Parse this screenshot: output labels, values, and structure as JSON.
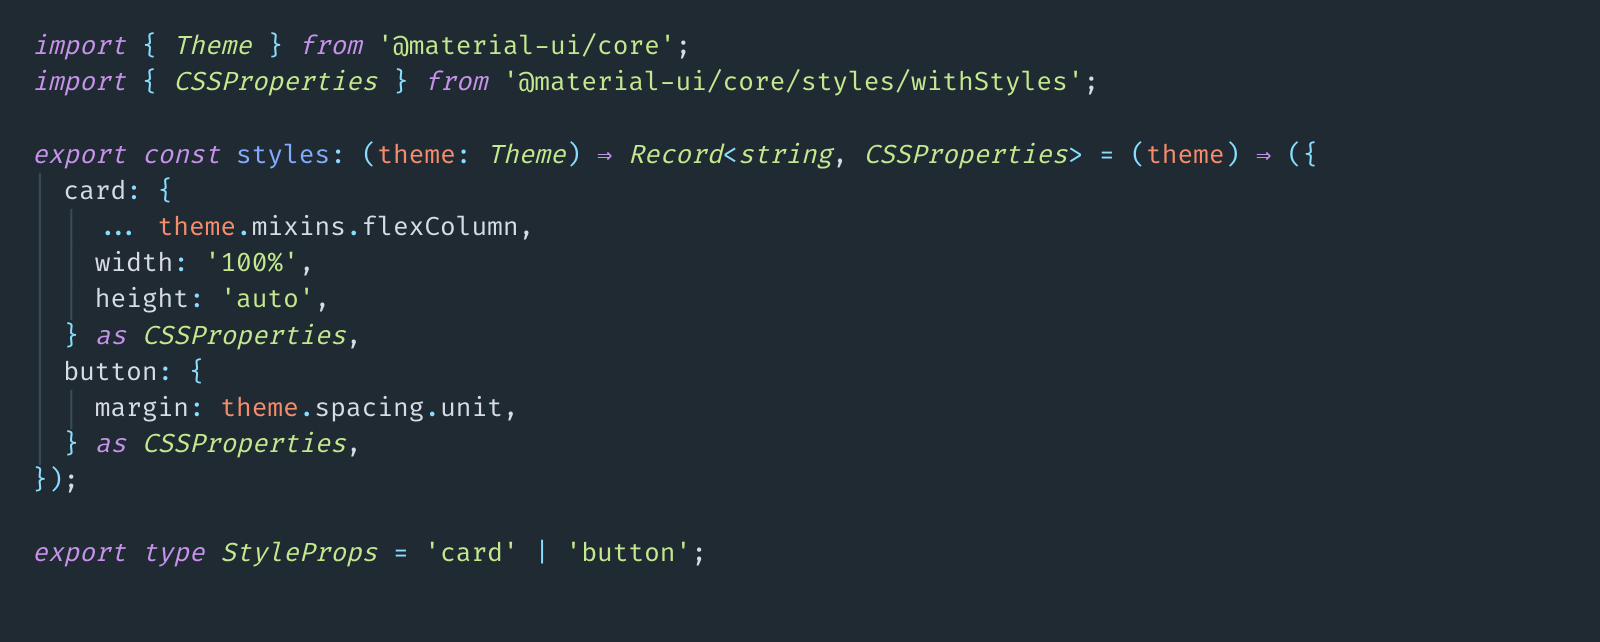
{
  "code": {
    "line1": {
      "import": "import",
      "lbrace": "{",
      "Theme": "Theme",
      "rbrace": "}",
      "from": "from",
      "pkg": "'@material-ui/core'",
      "semi": ";"
    },
    "line2": {
      "import": "import",
      "lbrace": "{",
      "CSSProperties": "CSSProperties",
      "rbrace": "}",
      "from": "from",
      "pkg": "'@material-ui/core/styles/withStyles'",
      "semi": ";"
    },
    "line4": {
      "export": "export",
      "const": "const",
      "styles": "styles",
      "colon": ":",
      "lp": "(",
      "theme1": "theme",
      "colon2": ":",
      "Theme": "Theme",
      "rp": ")",
      "arrow1": "⇒",
      "Record": "Record",
      "lt": "<",
      "string": "string",
      "comma": ",",
      "CSSProperties": "CSSProperties",
      "gt": ">",
      "eq": "=",
      "lp2": "(",
      "theme2": "theme",
      "rp2": ")",
      "arrow2": "⇒",
      "lp3": "(",
      "lbrace": "{"
    },
    "line5": {
      "card": "card",
      "colon": ":",
      "lbrace": "{"
    },
    "line6": {
      "spread": "...",
      "theme": "theme",
      "dot1": ".",
      "mixins": "mixins",
      "dot2": ".",
      "flexColumn": "flexColumn",
      "comma": ","
    },
    "line7": {
      "width": "width",
      "colon": ":",
      "val": "'100%'",
      "comma": ","
    },
    "line8": {
      "height": "height",
      "colon": ":",
      "val": "'auto'",
      "comma": ","
    },
    "line9": {
      "rbrace": "}",
      "as": "as",
      "CSSProperties": "CSSProperties",
      "comma": ","
    },
    "line10": {
      "button": "button",
      "colon": ":",
      "lbrace": "{"
    },
    "line11": {
      "margin": "margin",
      "colon": ":",
      "theme": "theme",
      "dot1": ".",
      "spacing": "spacing",
      "dot2": ".",
      "unit": "unit",
      "comma": ","
    },
    "line12": {
      "rbrace": "}",
      "as": "as",
      "CSSProperties": "CSSProperties",
      "comma": ","
    },
    "line13": {
      "rbrace": "}",
      "rp": ")",
      "semi": ";"
    },
    "line15": {
      "export": "export",
      "type": "type",
      "StyleProps": "StyleProps",
      "eq": "=",
      "card": "'card'",
      "pipe": "|",
      "button": "'button'",
      "semi": ";"
    }
  }
}
